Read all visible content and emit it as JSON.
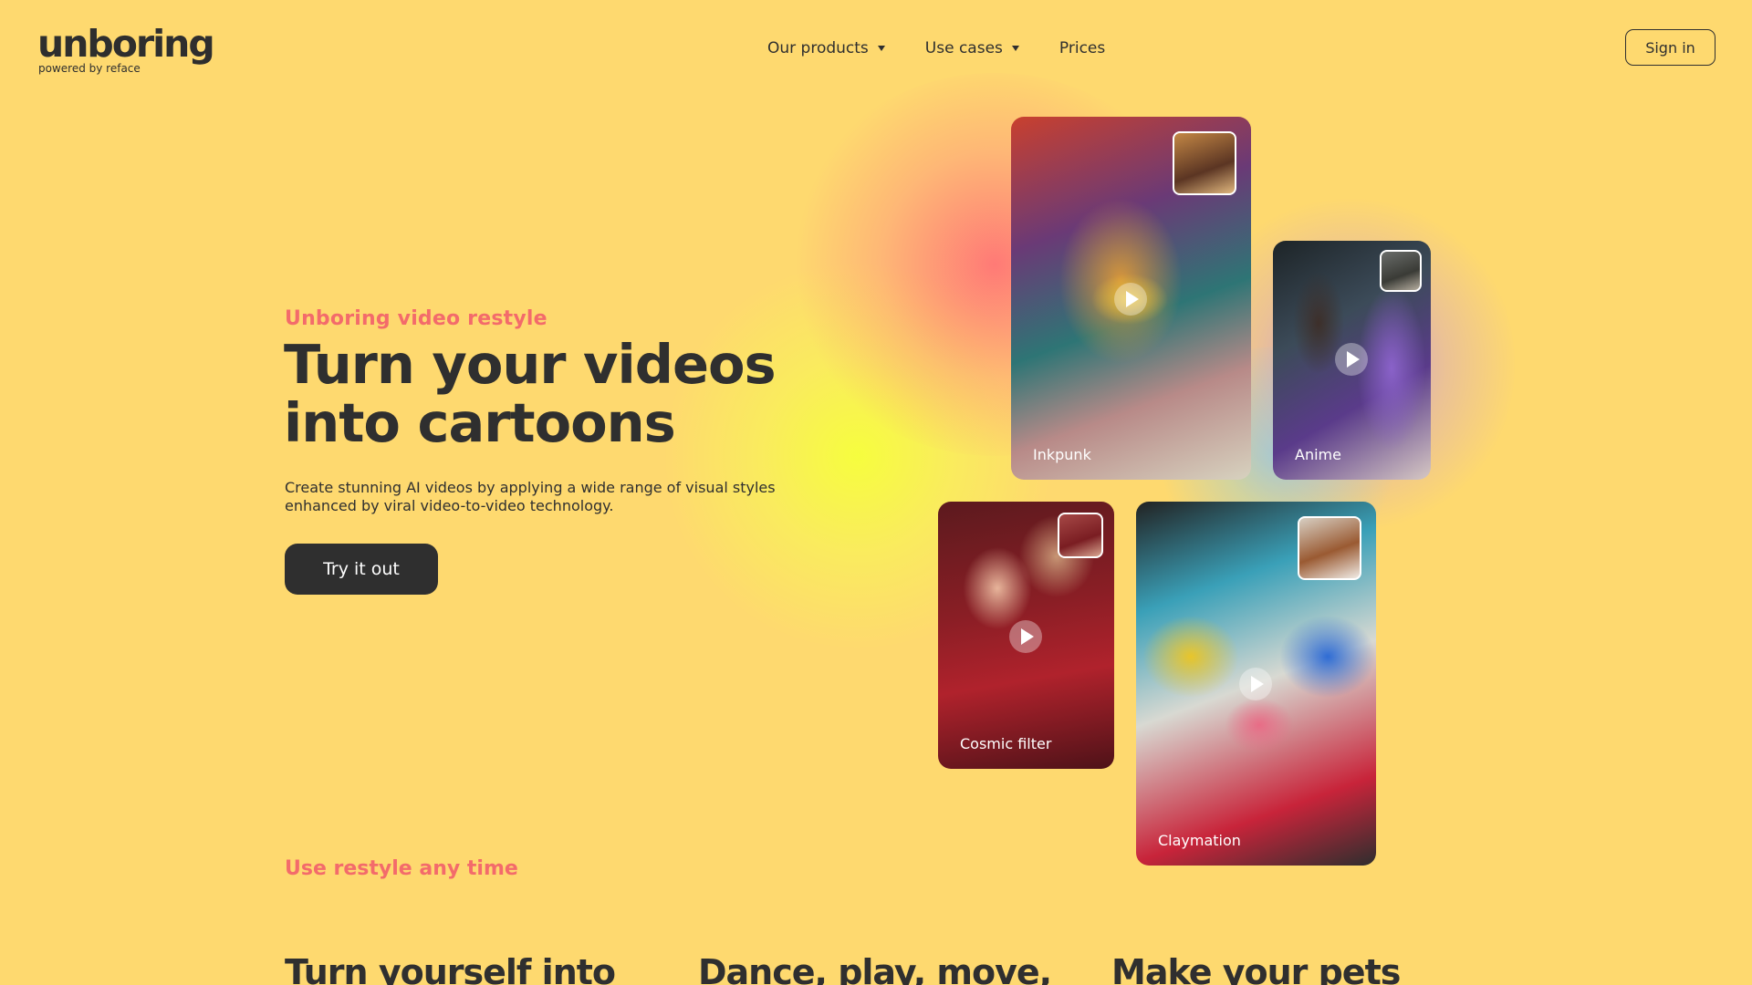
{
  "header": {
    "logo": "unboring",
    "logo_sub": "powered by reface",
    "nav": [
      {
        "label": "Our products",
        "has_dropdown": true
      },
      {
        "label": "Use cases",
        "has_dropdown": true
      },
      {
        "label": "Prices",
        "has_dropdown": false
      }
    ],
    "signin_label": "Sign in"
  },
  "hero": {
    "eyebrow": "Unboring video restyle",
    "headline_line1": "Turn your videos",
    "headline_line2": "into cartoons",
    "description": "Create stunning AI videos by applying a wide range of visual styles enhanced by viral video-to-video technology.",
    "cta_label": "Try it out"
  },
  "style_cards": [
    {
      "label": "Inkpunk"
    },
    {
      "label": "Anime"
    },
    {
      "label": "Cosmic filter"
    },
    {
      "label": "Claymation"
    }
  ],
  "use_cases": {
    "eyebrow": "Use restyle any time",
    "columns": [
      {
        "title": "Turn yourself into"
      },
      {
        "title": "Dance, play, move,"
      },
      {
        "title": "Make your pets"
      }
    ]
  },
  "colors": {
    "background": "#fed96f",
    "accent": "#f36b6b",
    "text": "#2f2f2f"
  }
}
